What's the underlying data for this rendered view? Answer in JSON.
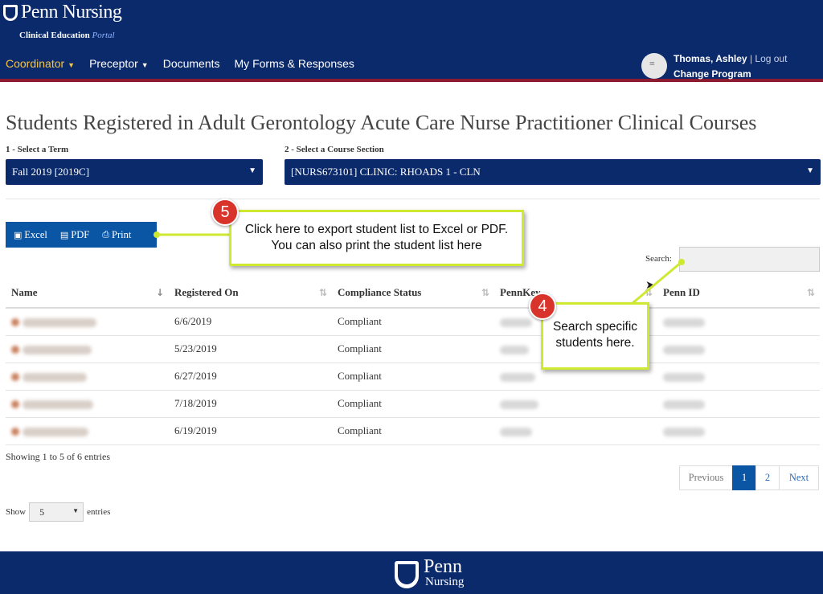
{
  "brand": {
    "name": "Penn Nursing",
    "sub": "Clinical Education",
    "sub_em": "Portal"
  },
  "nav": [
    {
      "label": "Coordinator",
      "active": true,
      "dropdown": true
    },
    {
      "label": "Preceptor",
      "active": false,
      "dropdown": true
    },
    {
      "label": "Documents",
      "active": false,
      "dropdown": false
    },
    {
      "label": "My Forms & Responses",
      "active": false,
      "dropdown": false
    }
  ],
  "user": {
    "name": "Thomas, Ashley",
    "separator": "|",
    "logout": "Log out",
    "change_program": "Change Program"
  },
  "page_title": "Students Registered in Adult Gerontology Acute Care Nurse Practitioner Clinical Courses",
  "term": {
    "label": "1 - Select a Term",
    "value": "Fall 2019 [2019C]"
  },
  "section": {
    "label": "2 - Select a Course Section",
    "value": "[NURS673101] CLINIC: RHOADS 1 - CLN"
  },
  "exports": {
    "excel": "Excel",
    "pdf": "PDF",
    "print": "Print"
  },
  "search": {
    "label": "Search:",
    "value": ""
  },
  "table": {
    "headers": [
      "Name",
      "Registered On",
      "Compliance Status",
      "PennKey",
      "Penn ID"
    ],
    "rows": [
      {
        "registered": "6/6/2019",
        "status": "Compliant"
      },
      {
        "registered": "5/23/2019",
        "status": "Compliant"
      },
      {
        "registered": "6/27/2019",
        "status": "Compliant"
      },
      {
        "registered": "7/18/2019",
        "status": "Compliant"
      },
      {
        "registered": "6/19/2019",
        "status": "Compliant"
      }
    ]
  },
  "info": "Showing 1 to 5 of 6 entries",
  "pager": {
    "prev": "Previous",
    "pages": [
      "1",
      "2"
    ],
    "next": "Next",
    "current": "1"
  },
  "length": {
    "show": "Show",
    "value": "5",
    "entries": "entries"
  },
  "footer": {
    "line1": "Penn",
    "line2": "Nursing"
  },
  "callouts": [
    {
      "number": "5",
      "text": "Click here to export student list to Excel or PDF. You can also print the student list here"
    },
    {
      "number": "4",
      "text": "Search specific students here."
    }
  ],
  "colors": {
    "navy": "#0b2a6b",
    "accent_red": "#8c1b2f",
    "button_blue": "#0a56a4",
    "nav_active": "#f5c542",
    "callout_border": "#cfe832",
    "badge_red": "#d9342b"
  }
}
